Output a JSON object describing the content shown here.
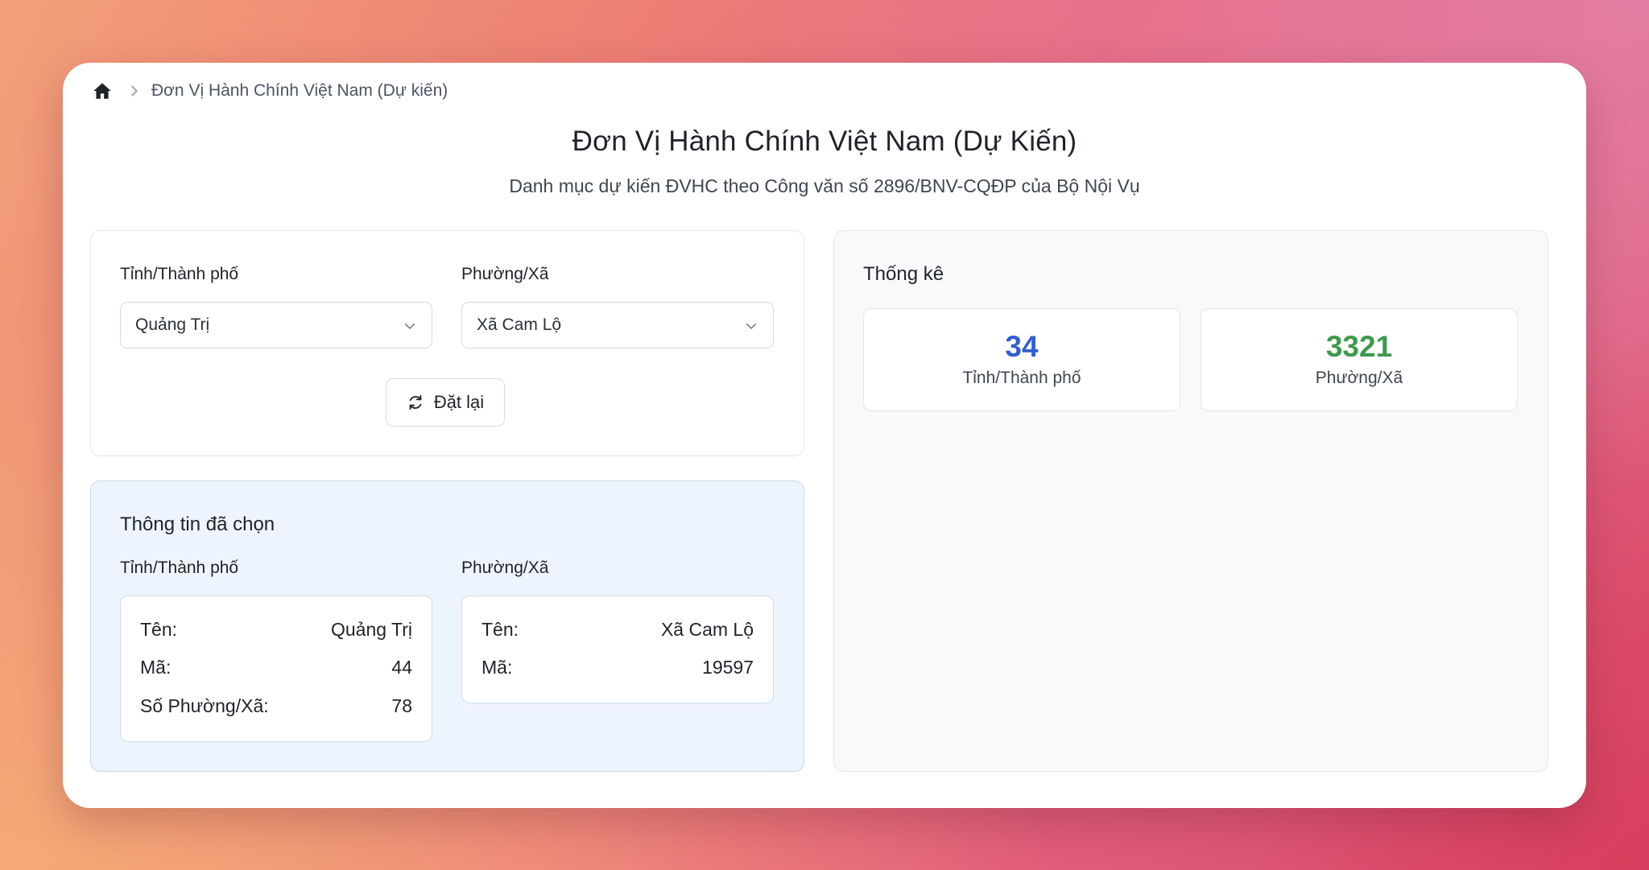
{
  "breadcrumb": {
    "current": "Đơn Vị Hành Chính Việt Nam (Dự kiến)"
  },
  "header": {
    "title": "Đơn Vị Hành Chính Việt Nam (Dự Kiến)",
    "subtitle": "Danh mục dự kiến ĐVHC theo Công văn số 2896/BNV-CQĐP của Bộ Nội Vụ"
  },
  "filters": {
    "province_label": "Tỉnh/Thành phố",
    "province_value": "Quảng Trị",
    "ward_label": "Phường/Xã",
    "ward_value": "Xã Cam Lộ",
    "reset_label": "Đặt lại"
  },
  "selected": {
    "title": "Thông tin đã chọn",
    "province": {
      "heading": "Tỉnh/Thành phố",
      "name_label": "Tên:",
      "name_value": "Quảng Trị",
      "code_label": "Mã:",
      "code_value": "44",
      "count_label": "Số Phường/Xã:",
      "count_value": "78"
    },
    "ward": {
      "heading": "Phường/Xã",
      "name_label": "Tên:",
      "name_value": "Xã Cam Lộ",
      "code_label": "Mã:",
      "code_value": "19597"
    }
  },
  "stats": {
    "title": "Thống kê",
    "provinces": {
      "value": "34",
      "label": "Tỉnh/Thành phố",
      "color": "#2f5fd0"
    },
    "wards": {
      "value": "3321",
      "label": "Phường/Xã",
      "color": "#3d9a4e"
    }
  },
  "icons": {
    "home": "home-icon",
    "breadcrumb_separator": "chevron-right-icon",
    "select_caret": "chevron-down-icon",
    "reset": "refresh-icon"
  }
}
